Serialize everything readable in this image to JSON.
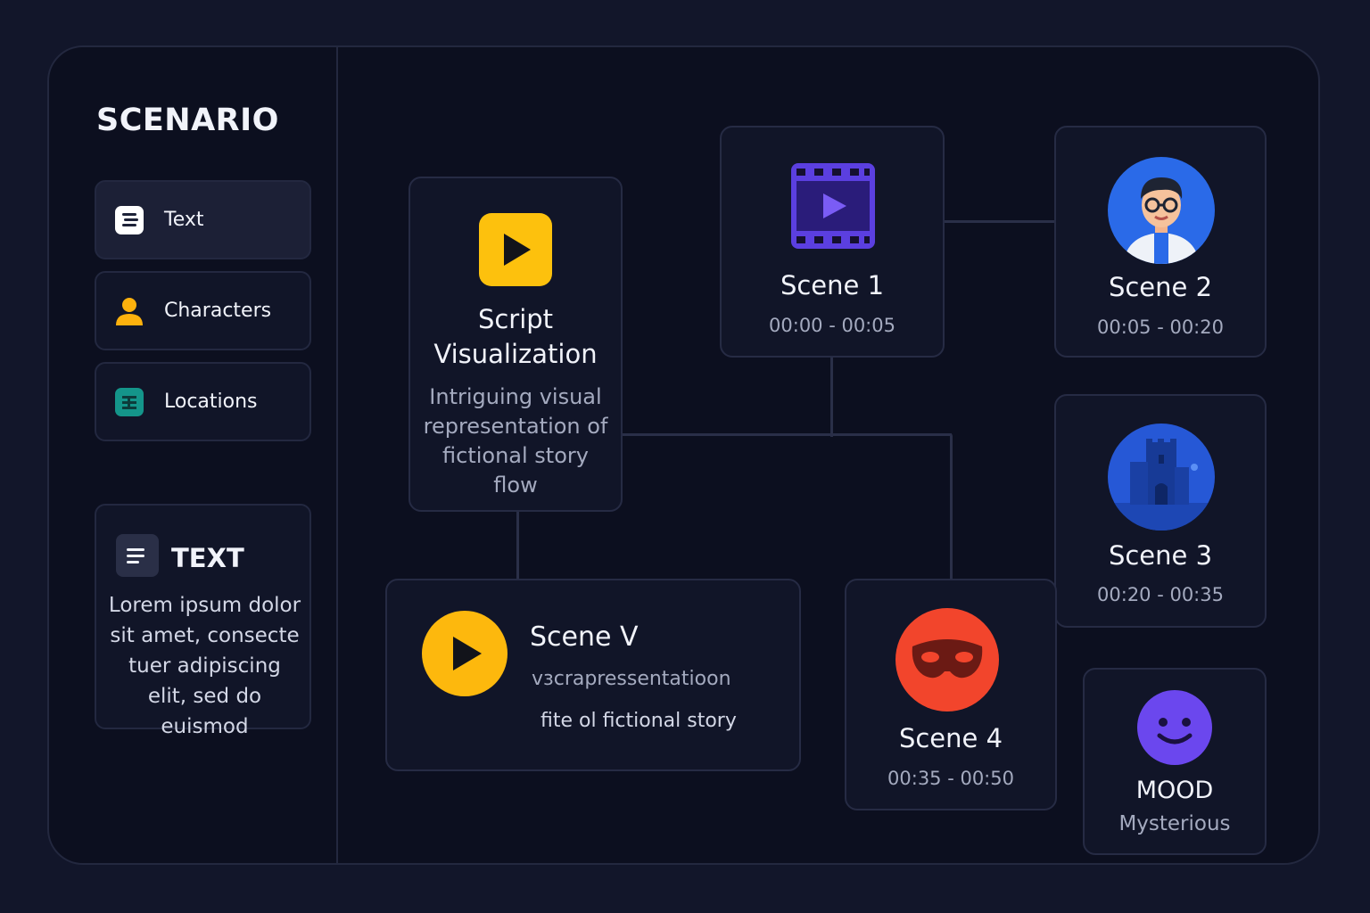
{
  "sidebar": {
    "title": "SCENARIO",
    "items": [
      {
        "label": "Text",
        "icon": "text-icon",
        "active": true
      },
      {
        "label": "Characters",
        "icon": "person-icon"
      },
      {
        "label": "Locations",
        "icon": "map-grid-icon"
      }
    ],
    "text_card": {
      "icon": "lines-icon",
      "title": "TEXT",
      "body": "Lorem ipsum dolor sit amet, consecte tuer adipiscing elit, sed do euismod"
    }
  },
  "canvas": {
    "script_card": {
      "icon": "play-icon",
      "title_line1": "Script",
      "title_line2": "Visualization",
      "description": "Intriguing visual representation of fictional story flow"
    },
    "scene1": {
      "icon": "film-strip-icon",
      "title": "Scene 1",
      "time": "00:00 - 00:05"
    },
    "scene2": {
      "icon": "character-avatar-icon",
      "title": "Scene 2",
      "time": "00:05 - 00:20"
    },
    "scene3": {
      "icon": "castle-icon",
      "title": "Scene 3",
      "time": "00:20 - 00:35"
    },
    "scene4": {
      "icon": "mask-icon",
      "title": "Scene 4",
      "time": "00:35 - 00:50"
    },
    "scene_v": {
      "icon": "play-circle-icon",
      "title": "Scene V",
      "line1": "vɜcrapressentatioon",
      "line2": "fite ol fictional story"
    },
    "mood": {
      "icon": "smiley-icon",
      "title": "MOOD",
      "value": "Mysterious"
    }
  },
  "colors": {
    "background": "#12162a",
    "panel": "#0c0f1f",
    "card": "#111528",
    "yellow": "#fdc10d",
    "purple": "#5b3fe0",
    "blue": "#2a6ae8",
    "red": "#f2452c",
    "teal": "#14958a",
    "muted_text": "#a4aabf"
  }
}
